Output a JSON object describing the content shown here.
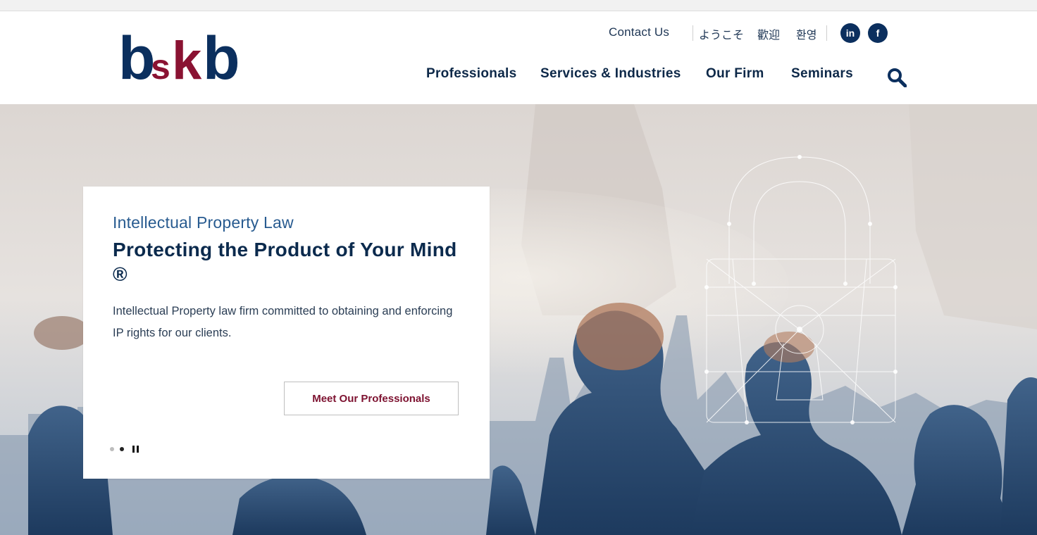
{
  "brand": {
    "logo_text": "bskb",
    "logo_colors": {
      "primary": "#0b2f5e",
      "accent": "#8a1232"
    }
  },
  "utility": {
    "contact": "Contact Us",
    "languages": [
      "ようこそ",
      "歡迎",
      "환영"
    ],
    "social": [
      {
        "label": "in",
        "icon": "linkedin-icon"
      },
      {
        "label": "f",
        "icon": "facebook-icon"
      }
    ]
  },
  "nav": {
    "items": [
      "Professionals",
      "Services & Industries",
      "Our Firm",
      "Seminars"
    ],
    "search_icon": "search-icon"
  },
  "hero": {
    "eyebrow": "Intellectual Property Law",
    "headline": "Protecting the Product of Your Mind ®",
    "body": "Intellectual Property law firm committed to obtaining and enforcing IP rights for our clients.",
    "cta": "Meet Our Professionals",
    "slide_count": 2,
    "active_slide": 2
  },
  "colors": {
    "navy": "#0b2a4d",
    "maroon": "#7d1230",
    "link_blue": "#285b90"
  }
}
